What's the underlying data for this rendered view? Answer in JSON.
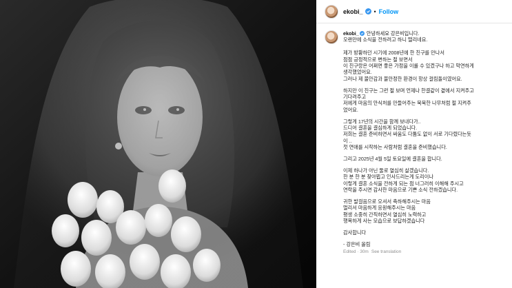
{
  "account": {
    "username": "ekobi_",
    "follow_label": "Follow",
    "separator": "•"
  },
  "caption": {
    "username": "ekobi_",
    "first_line": "안녕하세요 강은비입니다.",
    "paragraphs": [
      "오랜만에 소식을 전하려고 하니 떨리네요.",
      "제가 방황하던 시기에 2008년에 한 친구를 만나서\n점점 긍정적으로 변하는 절 보면서\n이 친구랑은 어쩌면 좋은 가정을 이룰 수 있겠구나 하고 막연하게\n생각했었어요.\n그러나 제 불안감과 불안정한 환경이 항상 걸림돌이였어요.",
      "하지만 이 친구는 그런 절 보며 언제나 한결같이 곁에서 지켜주고\n기다려주고\n저에게 마음의 안식처를 만들어주는 묵묵한 나무처럼 절 지켜주\n었어요.",
      "그렇게 17년의 시간을 함께 보내다가..\n드디어 결혼을 결심하게 되었습니다.\n저희는 결혼 준비하면서 싸움도 다툼도 없이 서로 기다렸다는듯\n이 ..\n첫 연애를 시작하는 사람처럼 결혼을 준비했습니다.",
      "그리고 2025년 4월 5일 토요일에 결혼을 합니다.",
      "이제 하나가 아닌 둘로 열심히 살겠습니다.\n한 분 한 분 찾아뵙고 인사드리는게 도리이나\n이렇게 결혼 소식을 전하게 되는 점 너그러히 이해해 주시고\n연락을 주시면 감사한 마음으로 기쁜 소식 전하겠습니다.",
      "귀한 발걸음으로 오셔서 축하해주시는 마음\n멀리서 마음하게 응원해주시는 마음\n평생 소중히 간직하면서 열심히 노력하고\n행복하게 사는 모습으로 보답하겠습니다",
      "감사합니다",
      "- 강은비 올림"
    ],
    "meta": {
      "edited": "Edited · 30m",
      "see_translation": "See translation"
    }
  },
  "colors": {
    "follow_blue": "#0095f6",
    "verified_blue": "#3897f0"
  },
  "icons": {
    "verified": "verified-badge-icon",
    "avatar": "profile-avatar"
  }
}
